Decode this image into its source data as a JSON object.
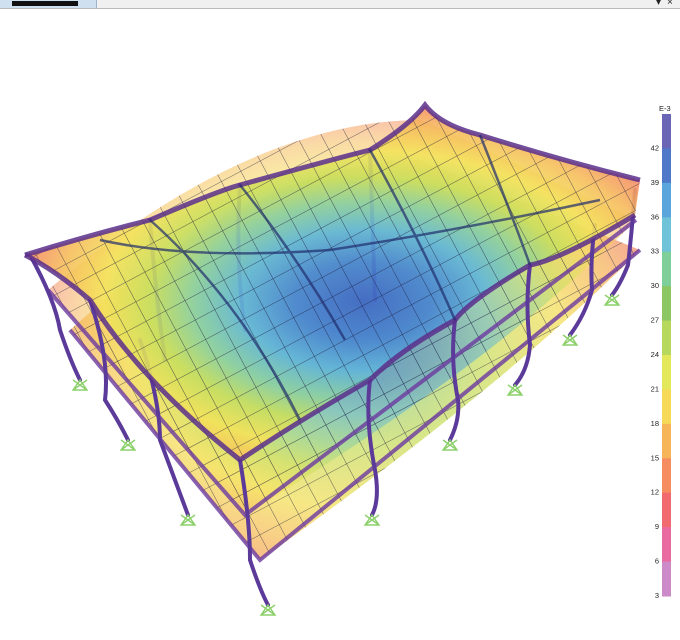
{
  "window": {
    "tab_title": "",
    "dropdown_icon": "chevron-down-icon",
    "close_icon": "close-icon"
  },
  "legend": {
    "unit": "E-3",
    "labels": [
      "42",
      "39",
      "36",
      "33",
      "30",
      "27",
      "24",
      "21",
      "18",
      "15",
      "12",
      "9",
      "6",
      "3"
    ],
    "colors": [
      "#6a66b5",
      "#4f79c8",
      "#5aa6dc",
      "#6fc3d8",
      "#7fcf9a",
      "#8cc764",
      "#b6d85c",
      "#e3e85a",
      "#f5d957",
      "#f7b55a",
      "#f58d60",
      "#f06a6f",
      "#e96aa0",
      "#cc8ac9"
    ]
  },
  "model": {
    "support_icon": "fixed-support-icon",
    "floor_levels": 3
  }
}
